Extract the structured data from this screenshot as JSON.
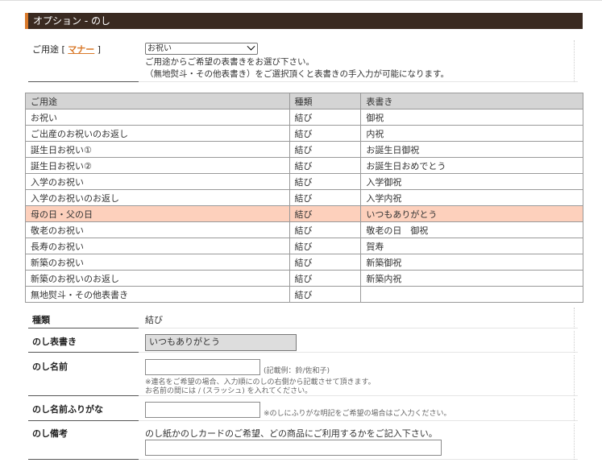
{
  "section": {
    "title": "オプション - のし"
  },
  "usage": {
    "label": "ご用途 [ ",
    "manner_link": "マナー",
    "label_close": " ]",
    "selected": "お祝い",
    "help1": "ご用途からご希望の表書きをお選び下さい。",
    "help2": "（無地熨斗・その他表書き）をご選択頂くと表書きの手入力が可能になります。"
  },
  "table": {
    "headers": [
      "ご用途",
      "種類",
      "表書き"
    ],
    "rows": [
      [
        "お祝い",
        "結び",
        "御祝"
      ],
      [
        "ご出産のお祝いのお返し",
        "結び",
        "内祝"
      ],
      [
        "誕生日お祝い①",
        "結び",
        "お誕生日御祝"
      ],
      [
        "誕生日お祝い②",
        "結び",
        "お誕生日おめでとう"
      ],
      [
        "入学のお祝い",
        "結び",
        "入学御祝"
      ],
      [
        "入学のお祝いのお返し",
        "結び",
        "入学内祝"
      ],
      [
        "母の日・父の日",
        "結び",
        "いつもありがとう"
      ],
      [
        "敬老のお祝い",
        "結び",
        "敬老の日　御祝"
      ],
      [
        "長寿のお祝い",
        "結び",
        "賀寿"
      ],
      [
        "新築のお祝い",
        "結び",
        "新築御祝"
      ],
      [
        "新築のお祝いのお返し",
        "結び",
        "新築内祝"
      ],
      [
        "無地熨斗・その他表書き",
        "結び",
        ""
      ]
    ],
    "highlight_color": "#fdd0bc"
  },
  "form": {
    "type": {
      "label": "種類",
      "value": "結び"
    },
    "omote": {
      "label": "のし表書き",
      "value": "いつもありがとう"
    },
    "name": {
      "label": "のし名前",
      "value": "",
      "example": "(記載例：鈴/佐和子)",
      "note1": "※連名をご希望の場合、入力順にのしの右側から記載させて頂きます。",
      "note2": "お名前の間には / (スラッシュ) を入れてください。"
    },
    "furigana": {
      "label": "のし名前ふりがな",
      "value": "",
      "note": "※のしにふりがな明記をご希望の場合はご入力ください。"
    },
    "bikou": {
      "label": "のし備考",
      "help": "のし紙かのしカードのご希望、どの商品にご利用するかをご記入下さい。",
      "value": ""
    }
  },
  "colors": {
    "header_bg": "#3a2a21",
    "accent": "#d9792a"
  }
}
